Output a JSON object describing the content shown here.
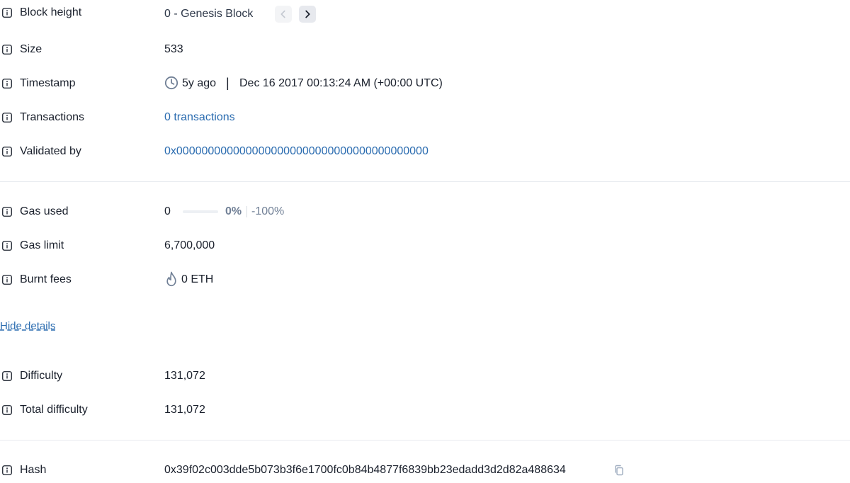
{
  "block_height": {
    "label": "Block height",
    "value": "0 - Genesis Block",
    "prev_icon": "chevron-left-icon",
    "next_icon": "chevron-right-icon"
  },
  "size": {
    "label": "Size",
    "value": "533"
  },
  "timestamp": {
    "label": "Timestamp",
    "relative": "5y ago",
    "separator": "|",
    "absolute": "Dec 16 2017 00:13:24 AM (+00:00 UTC)",
    "icon": "clock-icon"
  },
  "transactions": {
    "label": "Transactions",
    "value": "0 transactions"
  },
  "validated_by": {
    "label": "Validated by",
    "value": "0x0000000000000000000000000000000000000000"
  },
  "gas_used": {
    "label": "Gas used",
    "value": "0",
    "usage_fraction": 0,
    "percent": "0%",
    "target_diff": "-100%"
  },
  "gas_limit": {
    "label": "Gas limit",
    "value": "6,700,000"
  },
  "burnt_fees": {
    "label": "Burnt fees",
    "value": "0 ETH",
    "icon": "flame-icon"
  },
  "hide_details": "Hide details",
  "difficulty": {
    "label": "Difficulty",
    "value": "131,072"
  },
  "total_difficulty": {
    "label": "Total difficulty",
    "value": "131,072"
  },
  "hash": {
    "label": "Hash",
    "value": "0x39f02c003dde5b073b3f6e1700fc0b84b4877f6839bb23edadd3d2d82a488634",
    "copy_icon": "copy-icon"
  },
  "colors": {
    "text": "#1a202c",
    "link": "#2b6cb0",
    "muted": "#718096",
    "divider": "#e8ebef"
  }
}
